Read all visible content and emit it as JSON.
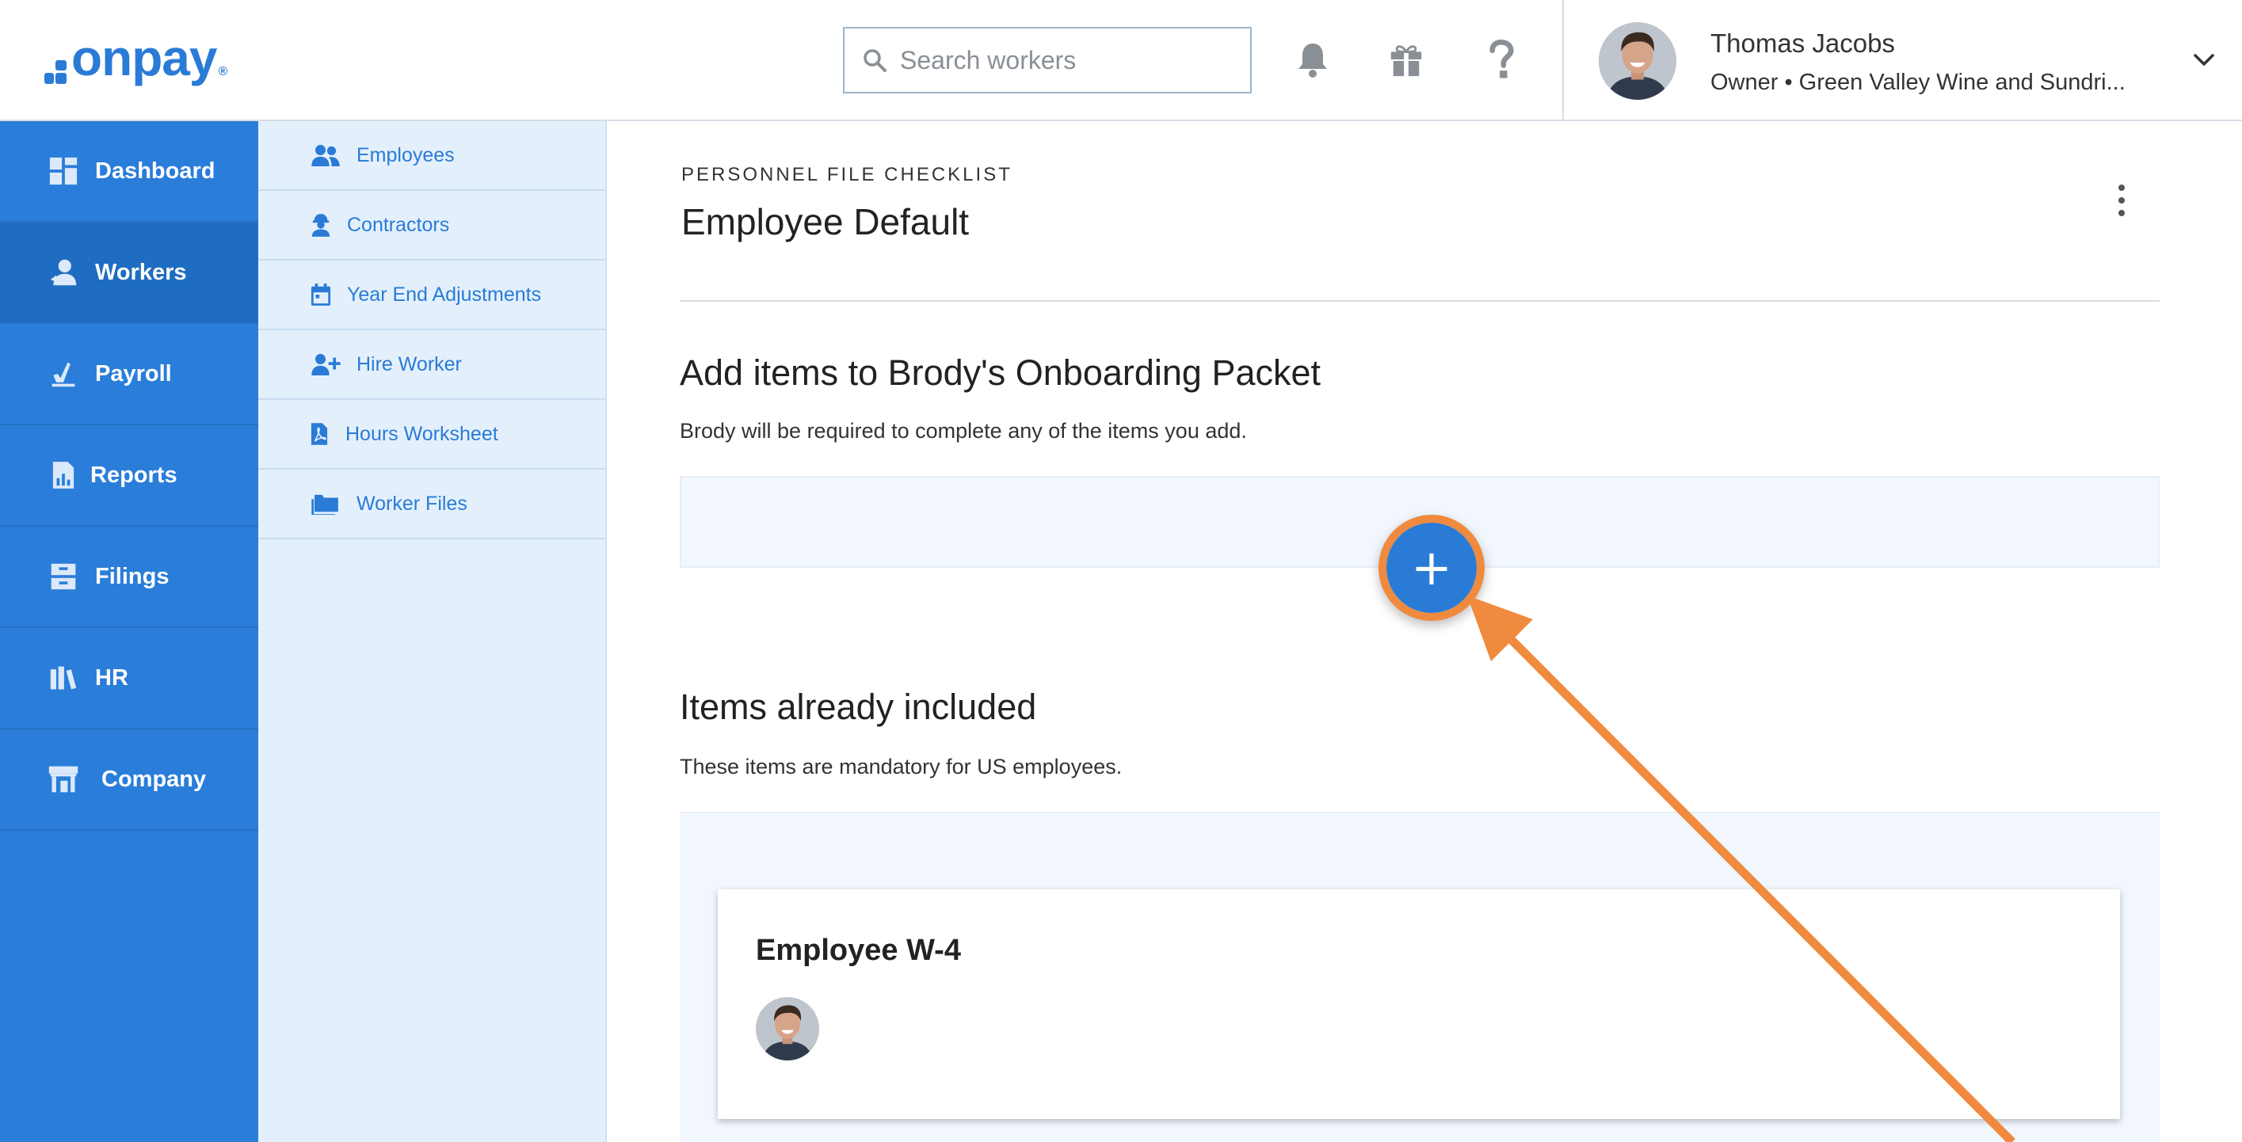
{
  "header": {
    "logo_text": "onpay",
    "logo_mark": "®",
    "search": {
      "placeholder": "Search workers",
      "value": ""
    },
    "icons": [
      "bell-icon",
      "gift-icon",
      "help-icon"
    ],
    "user": {
      "name": "Thomas Jacobs",
      "role": "Owner • Green Valley Wine and Sundri..."
    }
  },
  "sidebar": {
    "items": [
      {
        "label": "Dashboard",
        "icon": "dashboard-icon",
        "active": false
      },
      {
        "label": "Workers",
        "icon": "workers-icon",
        "active": true
      },
      {
        "label": "Payroll",
        "icon": "payroll-icon",
        "active": false
      },
      {
        "label": "Reports",
        "icon": "reports-icon",
        "active": false
      },
      {
        "label": "Filings",
        "icon": "filings-icon",
        "active": false
      },
      {
        "label": "HR",
        "icon": "hr-icon",
        "active": false
      },
      {
        "label": "Company",
        "icon": "company-icon",
        "active": false
      }
    ]
  },
  "subnav": {
    "items": [
      {
        "label": "Employees",
        "icon": "employees-icon"
      },
      {
        "label": "Contractors",
        "icon": "contractors-icon"
      },
      {
        "label": "Year End Adjustments",
        "icon": "calendar-icon"
      },
      {
        "label": "Hire Worker",
        "icon": "add-user-icon"
      },
      {
        "label": "Hours Worksheet",
        "icon": "pdf-icon"
      },
      {
        "label": "Worker Files",
        "icon": "folder-icon"
      }
    ]
  },
  "main": {
    "eyebrow": "PERSONNEL FILE CHECKLIST",
    "title": "Employee Default",
    "add_section": {
      "title": "Add items to Brody's Onboarding Packet",
      "description": "Brody will be required to complete any of the items you add.",
      "add_button_label": "+"
    },
    "included_section": {
      "title": "Items already included",
      "description": "These items are mandatory for US employees.",
      "cards": [
        {
          "title": "Employee W-4"
        }
      ]
    }
  },
  "colors": {
    "brand_blue": "#2a7bd6",
    "sidebar_blue": "#2a7dd9",
    "highlight_orange": "#ef8a3e"
  }
}
